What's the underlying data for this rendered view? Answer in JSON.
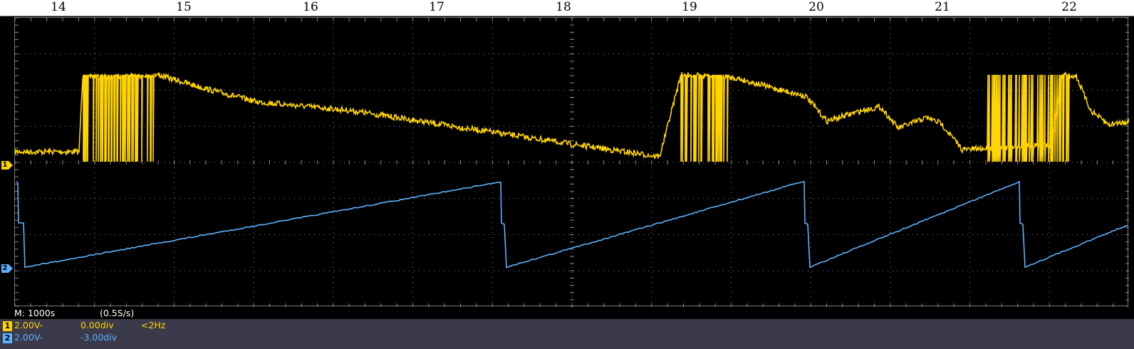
{
  "top_scale": {
    "labels": [
      "14",
      "15",
      "16",
      "17",
      "18",
      "19",
      "20",
      "21",
      "22"
    ]
  },
  "channels": [
    {
      "id": "1",
      "marker": "1",
      "color": "#ffd400"
    },
    {
      "id": "2",
      "marker": "2",
      "color": "#5cb2ff"
    }
  ],
  "status": {
    "timebase": "M: 1000s",
    "sample_rate": "(0.5S/s)",
    "ch1": {
      "label": "1",
      "scale": "2.00V-",
      "offset": "0.00div",
      "freq": "<2Hz"
    },
    "ch2": {
      "label": "2",
      "scale": "2.00V-",
      "offset": "-3.00div"
    }
  },
  "colors": {
    "ch1": "#ffd400",
    "ch2": "#5cb2ff",
    "grid": "#8a8a8a",
    "background": "#000000"
  }
}
